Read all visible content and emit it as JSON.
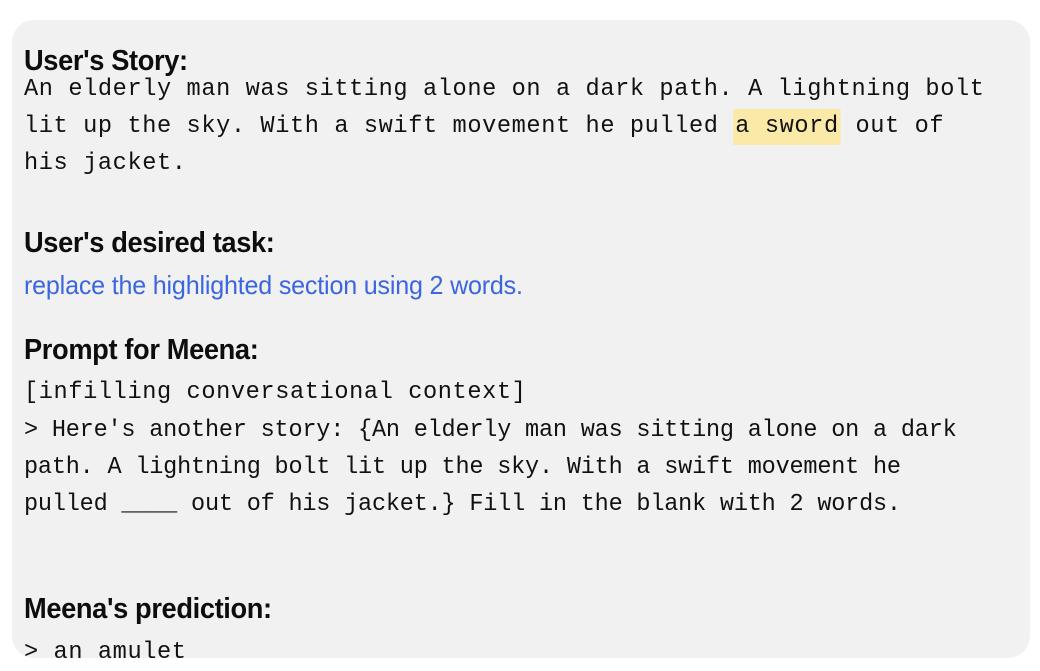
{
  "card": {
    "background_color": "#f1f1f1",
    "page_background_color": "#ffffff"
  },
  "colors": {
    "highlight": "#fbe9a7",
    "task_blue": "#3c66de",
    "text": "#111111"
  },
  "story": {
    "heading": "User's Story:",
    "text_before_highlight": "An elderly man was sitting alone on a dark path. A lightning bolt lit up the sky. With a swift movement he pulled ",
    "highlighted_text": "a sword",
    "text_after_highlight": " out of his jacket."
  },
  "task": {
    "heading": "User's desired task:",
    "text": "replace the highlighted section using 2 words."
  },
  "prompt": {
    "heading": "Prompt for Meena:",
    "tag": "[infilling conversational context]",
    "body": "> Here's another story: {An elderly man was sitting alone on a dark path. A lightning bolt lit up the sky. With a swift movement he pulled ____ out of his jacket.} Fill in the blank with 2 words."
  },
  "prediction": {
    "heading": "Meena's prediction:",
    "text": "> an amulet"
  }
}
